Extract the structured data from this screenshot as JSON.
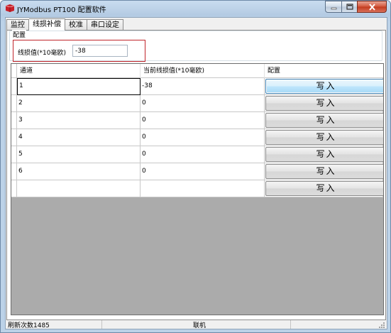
{
  "window": {
    "title": "JYModbus  PT100 配置软件",
    "icon": "app-logo-icon",
    "controls": [
      "minimize-icon",
      "maximize-icon",
      "close-icon"
    ]
  },
  "tabs": [
    "监控",
    "线损补偿",
    "校准",
    "串口设定"
  ],
  "active_tab": "线损补偿",
  "config_group": {
    "label": "配置",
    "field_label": "线损值(*10毫欧)",
    "field_value": "-38"
  },
  "grid": {
    "columns": [
      "通道",
      "当前线损值(*10毫欧)",
      "配置"
    ],
    "rows": [
      {
        "channel": "1",
        "value": "-38",
        "button": "写入"
      },
      {
        "channel": "2",
        "value": "0",
        "button": "写入"
      },
      {
        "channel": "3",
        "value": "0",
        "button": "写入"
      },
      {
        "channel": "4",
        "value": "0",
        "button": "写入"
      },
      {
        "channel": "5",
        "value": "0",
        "button": "写入"
      },
      {
        "channel": "6",
        "value": "0",
        "button": "写入"
      },
      {
        "channel": "",
        "value": "",
        "button": "写入"
      }
    ]
  },
  "status": {
    "refresh": "刷新次数1485",
    "connection": "联机"
  },
  "colors": {
    "highlight_frame": "#c0242a",
    "grid_background": "#ababab",
    "focused_button": "#bee6fd"
  }
}
